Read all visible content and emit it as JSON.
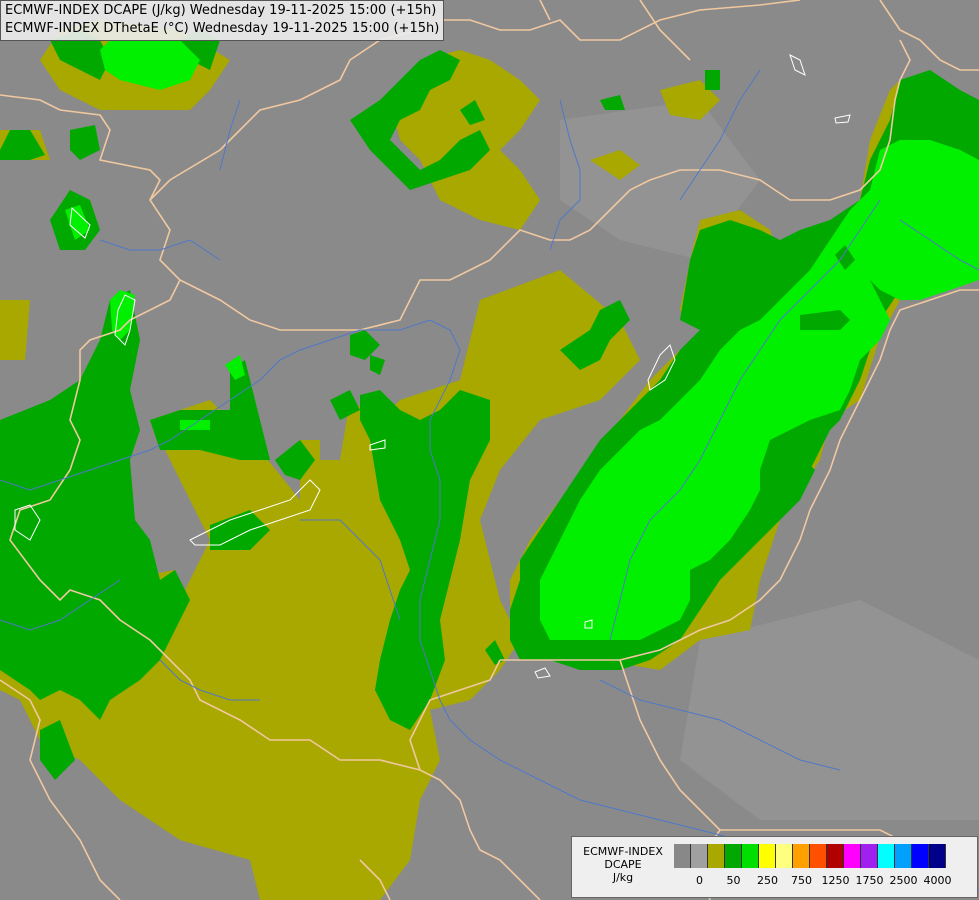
{
  "map": {
    "titles": [
      "ECMWF-INDEX DCAPE (J/kg) Wednesday 19-11-2025 15:00 (+15h)",
      "ECMWF-INDEX DThetaE (°C) Wednesday 19-11-2025 15:00 (+15h)"
    ],
    "colors": {
      "background": "#8a8a8a",
      "olive": "#a8a800",
      "green": "#00a800",
      "lime": "#00f000",
      "borders": "#f0c8a0",
      "rivers": "#5078c8",
      "contour": "#ffffff"
    }
  },
  "legend": {
    "label_lines": [
      "ECMWF-INDEX",
      "DCAPE",
      "J/kg"
    ],
    "swatches": [
      "#888888",
      "#a0a0a0",
      "#a8a800",
      "#00a800",
      "#00e000",
      "#ffff00",
      "#ffff80",
      "#ffa000",
      "#ff5000",
      "#b00000",
      "#ff00ff",
      "#a020f0",
      "#00ffff",
      "#00a0ff",
      "#0000ff",
      "#00008b"
    ],
    "ticks": [
      "0",
      "50",
      "250",
      "750",
      "1250",
      "1750",
      "2500",
      "4000"
    ]
  }
}
